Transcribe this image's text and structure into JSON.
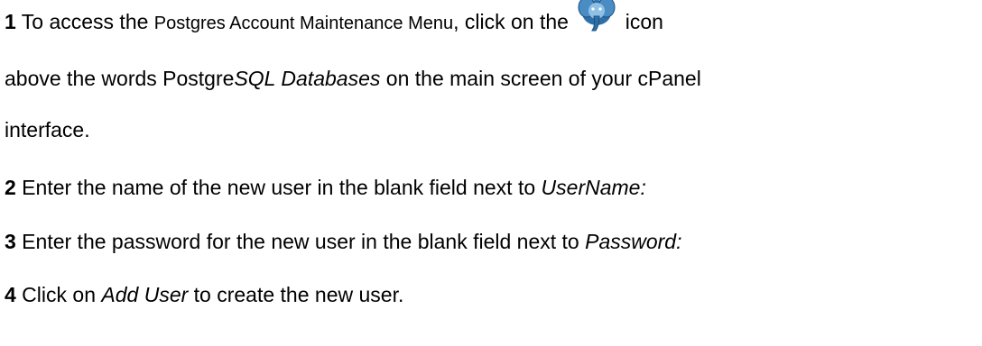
{
  "steps": [
    {
      "number": "1",
      "text_a": " To access the ",
      "menu_name": "Postgres Account Maintenance Menu",
      "text_b": ", click on the ",
      "icon": "postgresql-elephant-icon",
      "text_c": " icon",
      "line2_a": "above the words Postgre",
      "line2_italic": "SQL Databases",
      "line2_b": " on the main screen of your cPanel",
      "line3": "interface."
    },
    {
      "number": "2",
      "text": " Enter the name of the new user in the blank field next to ",
      "field": "UserName:"
    },
    {
      "number": "3",
      "text": " Enter the password for the new user in the blank field next to ",
      "field": "Password:"
    },
    {
      "number": "4",
      "text_a": " Click on ",
      "button": "Add User",
      "text_b": " to create the new user."
    }
  ],
  "colors": {
    "text": "#000000",
    "icon_primary": "#2f6fa8",
    "icon_light": "#8fc1e6"
  }
}
